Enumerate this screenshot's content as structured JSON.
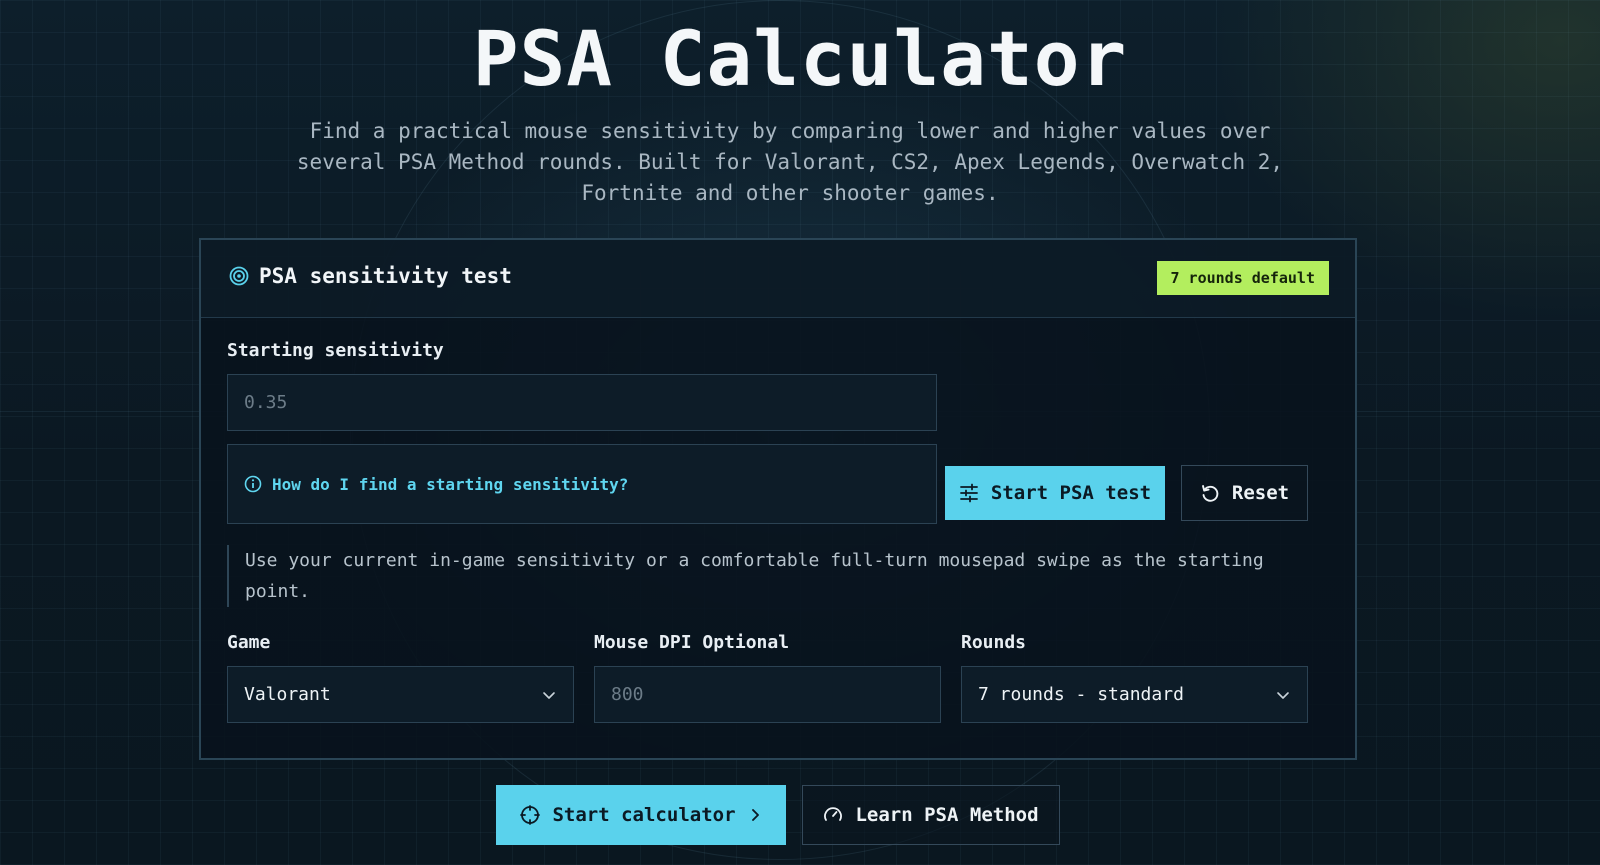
{
  "header": {
    "title": "PSA Calculator",
    "subtitle": "Find a practical mouse sensitivity by comparing lower and higher values over several PSA Method rounds. Built for Valorant, CS2, Apex Legends, Overwatch 2, Fortnite and other shooter games."
  },
  "card": {
    "title": "PSA sensitivity test",
    "badge": "7 rounds default",
    "starting_sensitivity": {
      "label": "Starting sensitivity",
      "placeholder": "0.35"
    },
    "help_link": "How do I find a starting sensitivity?",
    "start_button": "Start PSA test",
    "reset_button": "Reset",
    "note": "Use your current in-game sensitivity or a comfortable full-turn mousepad swipe as the starting point.",
    "game": {
      "label": "Game",
      "selected": "Valorant"
    },
    "dpi": {
      "label": "Mouse DPI Optional",
      "placeholder": "800"
    },
    "rounds": {
      "label": "Rounds",
      "selected": "7 rounds - standard"
    }
  },
  "footer": {
    "start_calculator": "Start calculator",
    "learn_method": "Learn PSA Method"
  },
  "colors": {
    "accent": "#5ad2ec",
    "badge": "#b3ee5e",
    "background": "#0a1620"
  }
}
